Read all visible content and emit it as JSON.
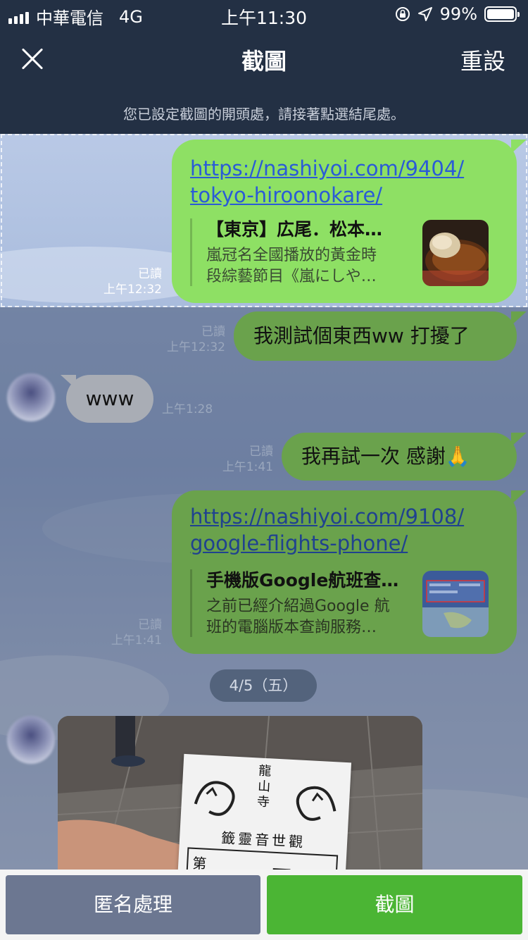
{
  "status_bar": {
    "carrier": "中華電信",
    "network": "4G",
    "time": "上午11:30",
    "battery": "99%",
    "battery_level": 0.99
  },
  "header": {
    "title": "截圖",
    "reset_label": "重設",
    "close_icon": "close-icon",
    "hint": "您已設定截圖的開頭處，請接著點選結尾處。"
  },
  "messages": [
    {
      "type": "link",
      "url_line1": "https://nashiyoi.com/9404/",
      "url_line2": "tokyo-hiroonokare/",
      "preview_title": "【東京】広尾．松本…",
      "preview_desc_line1": "嵐冠名全國播放的黃金時",
      "preview_desc_line2": "段綜藝節目《嵐にしや…",
      "read": "已讀",
      "time": "上午12:32"
    },
    {
      "type": "text",
      "text": "我測試個東西ww 打擾了",
      "read": "已讀",
      "time": "上午12:32"
    },
    {
      "type": "incoming",
      "text": "www",
      "time": "上午1:28"
    },
    {
      "type": "text",
      "text": "我再試一次 感謝🙏",
      "read": "已讀",
      "time": "上午1:41"
    },
    {
      "type": "link",
      "url_line1": "https://nashiyoi.com/9108/",
      "url_line2": "google-flights-phone/",
      "preview_title": "手機版Google航班查…",
      "preview_desc_line1": "之前已經介紹過Google 航",
      "preview_desc_line2": "班的電腦版本查詢服務…",
      "read": "已讀",
      "time": "上午1:41"
    }
  ],
  "date_separator": "4/5（五）",
  "photo_text": {
    "temple": "龍山寺",
    "title": "籤靈音世觀",
    "row": "第",
    "char": "一"
  },
  "bottom_bar": {
    "anonymize_label": "匿名處理",
    "screenshot_label": "截圖"
  },
  "colors": {
    "header_bg": "#233044",
    "bubble_green": "#8ee064",
    "anonymize_button": "#6c7791",
    "screenshot_button": "#4bb534",
    "link_blue": "#2a5bd7"
  }
}
